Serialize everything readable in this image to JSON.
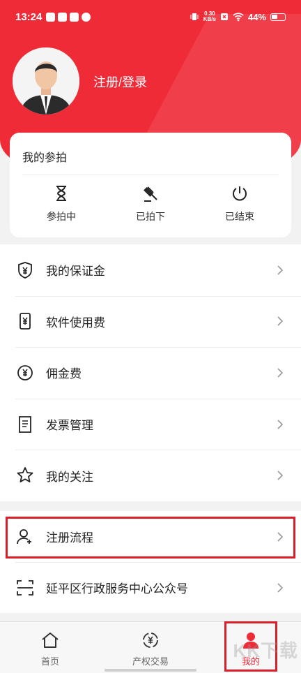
{
  "status": {
    "time": "13:24",
    "net_speed_top": "0.30",
    "net_speed_bottom": "KB/s",
    "battery": "44%"
  },
  "header": {
    "login_text": "注册/登录"
  },
  "auction": {
    "title": "我的参拍",
    "items": [
      {
        "label": "参拍中",
        "icon": "hourglass-icon"
      },
      {
        "label": "已拍下",
        "icon": "gavel-icon"
      },
      {
        "label": "已结束",
        "icon": "power-icon"
      }
    ]
  },
  "menu": {
    "items": [
      {
        "label": "我的保证金",
        "icon": "shield-yen-icon"
      },
      {
        "label": "软件使用费",
        "icon": "phone-yen-icon"
      },
      {
        "label": "佣金费",
        "icon": "coin-yen-icon"
      },
      {
        "label": "发票管理",
        "icon": "invoice-icon"
      },
      {
        "label": "我的关注",
        "icon": "star-icon"
      }
    ],
    "items2": [
      {
        "label": "注册流程",
        "icon": "user-add-icon"
      },
      {
        "label": "延平区行政服务中心公众号",
        "icon": "scan-icon"
      }
    ]
  },
  "tabbar": {
    "tabs": [
      {
        "label": "首页",
        "icon": "home-icon"
      },
      {
        "label": "产权交易",
        "icon": "exchange-icon"
      },
      {
        "label": "我的",
        "icon": "user-icon"
      }
    ],
    "active": "我的"
  },
  "watermark": "KK下载",
  "colors": {
    "primary": "#ef2b38",
    "highlight_box": "#d81f2a"
  }
}
